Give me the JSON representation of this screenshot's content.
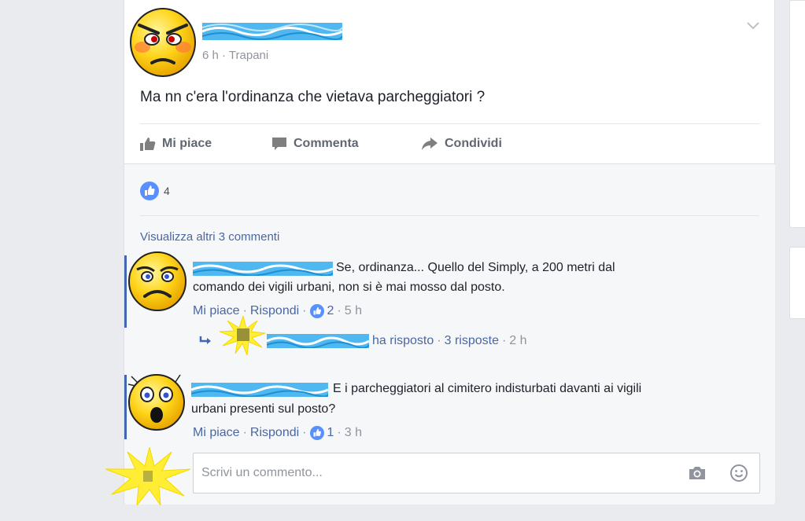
{
  "post": {
    "meta": "6 h · Trapani",
    "text": "Ma nn c'era l'ordinanza che vietava parcheggiatori ?",
    "actions": {
      "like": "Mi piace",
      "comment": "Commenta",
      "share": "Condividi"
    },
    "reaction_count": "4"
  },
  "comments": {
    "view_more": "Visualizza altri 3 commenti",
    "items": [
      {
        "text_line1": "Se, ordinanza... Quello del Simply, a 200 metri dal",
        "text_line2": "comando dei vigili urbani, non si è mai mosso dal posto.",
        "like": "Mi piace",
        "reply": "Rispondi",
        "likes": "2",
        "time": "5 h",
        "reply_summary": {
          "text": "ha risposto",
          "count": "3 risposte",
          "time": "2 h"
        }
      },
      {
        "text_line1": "E i parcheggiatori al cimitero indisturbati davanti ai vigili",
        "text_line2": "urbani presenti sul posto?",
        "like": "Mi piace",
        "reply": "Rispondi",
        "likes": "1",
        "time": "3 h"
      }
    ]
  },
  "composer": {
    "placeholder": "Scrivi un commento..."
  },
  "colors": {
    "accent": "#4267b2",
    "link": "#4b67a1",
    "muted": "#90949c",
    "background": "#e9ebee"
  },
  "icons": [
    "chevron-down-icon",
    "thumbs-up-icon",
    "comment-icon",
    "share-arrow-icon",
    "like-badge-icon",
    "reply-arrow-icon",
    "camera-icon",
    "smiley-icon"
  ]
}
